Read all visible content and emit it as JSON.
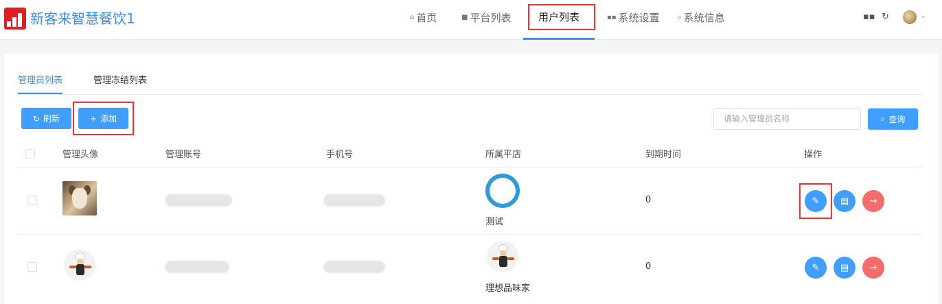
{
  "header": {
    "app_title": "新客来智慧餐饮1",
    "nav": [
      {
        "icon": "home-icon",
        "label": "首页"
      },
      {
        "icon": "list-icon",
        "label": "平台列表"
      },
      {
        "icon": "",
        "label": "用户列表"
      },
      {
        "icon": "grid-icon",
        "label": "系统设置"
      },
      {
        "icon": "search-icon",
        "label": "系统信息"
      }
    ],
    "active_nav": "用户列表"
  },
  "tabs": [
    {
      "label": "管理员列表",
      "active": true
    },
    {
      "label": "管理冻结列表",
      "active": false
    }
  ],
  "toolbar": {
    "refresh_label": "刷新",
    "add_label": "添加",
    "search_placeholder": "请输入管理员名称",
    "query_label": "查询"
  },
  "table": {
    "columns": [
      "管理头像",
      "管理账号",
      "手机号",
      "所属平店",
      "到期时间",
      "操作"
    ],
    "rows": [
      {
        "avatar": "dog-photo",
        "store_logo": "blue-network-logo",
        "store_name": "测试",
        "expire": "0"
      },
      {
        "avatar": "chef-illustration",
        "store_logo": "chef-illustration",
        "store_name": "理想品味家",
        "expire": "0"
      }
    ]
  },
  "colors": {
    "accent": "#409eff",
    "danger": "#f56c6c",
    "highlight_box": "#e33333"
  }
}
